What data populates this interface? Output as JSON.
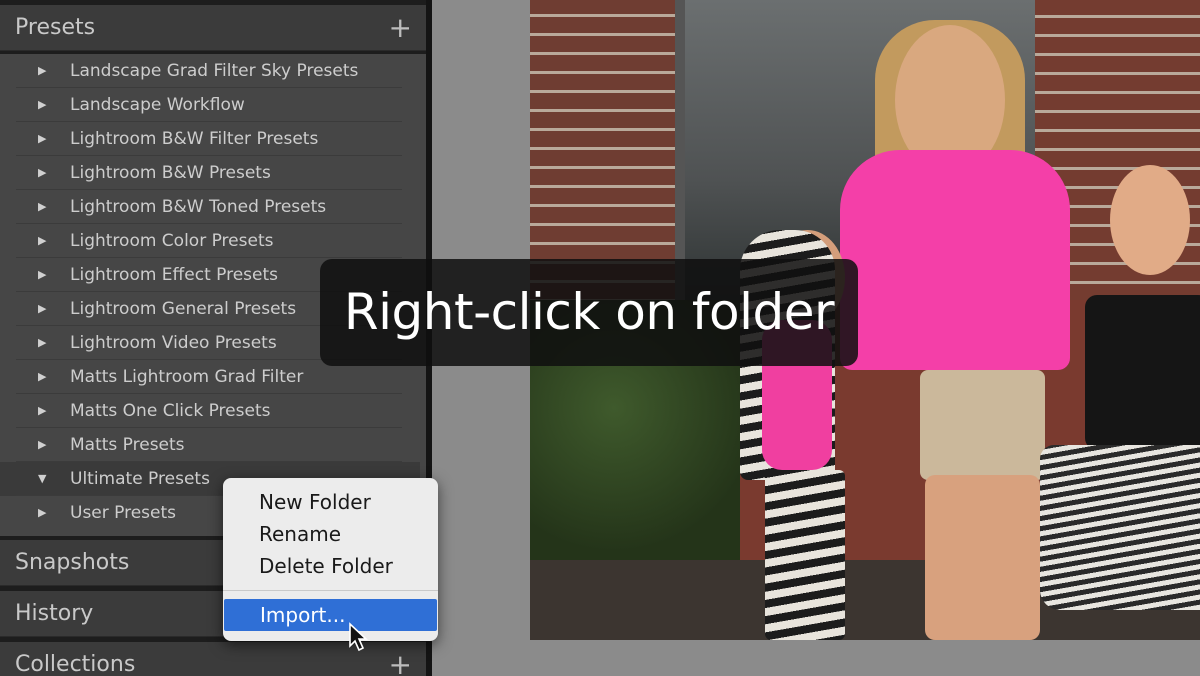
{
  "left_panel": {
    "presets": {
      "title": "Presets",
      "add_icon": "+",
      "items": [
        {
          "label": "Landscape Grad Filter Sky Presets",
          "expanded": false
        },
        {
          "label": "Landscape Workflow",
          "expanded": false
        },
        {
          "label": "Lightroom B&W Filter Presets",
          "expanded": false
        },
        {
          "label": "Lightroom B&W Presets",
          "expanded": false
        },
        {
          "label": "Lightroom B&W Toned Presets",
          "expanded": false
        },
        {
          "label": "Lightroom Color Presets",
          "expanded": false
        },
        {
          "label": "Lightroom Effect Presets",
          "expanded": false
        },
        {
          "label": "Lightroom General Presets",
          "expanded": false
        },
        {
          "label": "Lightroom Video Presets",
          "expanded": false
        },
        {
          "label": "Matts Lightroom Grad Filter",
          "expanded": false
        },
        {
          "label": "Matts One Click Presets",
          "expanded": false
        },
        {
          "label": "Matts Presets",
          "expanded": false
        },
        {
          "label": "Ultimate Presets",
          "expanded": true
        },
        {
          "label": "User Presets",
          "expanded": false
        }
      ]
    },
    "snapshots": {
      "title": "Snapshots"
    },
    "history": {
      "title": "History"
    },
    "collections": {
      "title": "Collections",
      "add_icon": "+"
    }
  },
  "caption": {
    "text": "Right-click on folder"
  },
  "context_menu": {
    "items": [
      {
        "label": "New Folder"
      },
      {
        "label": "Rename"
      },
      {
        "label": "Delete Folder"
      }
    ],
    "highlighted": {
      "label": "Import..."
    }
  },
  "icons": {
    "collapsed": "▶",
    "expanded": "▼",
    "highlight_color": "#2f6fd6"
  }
}
